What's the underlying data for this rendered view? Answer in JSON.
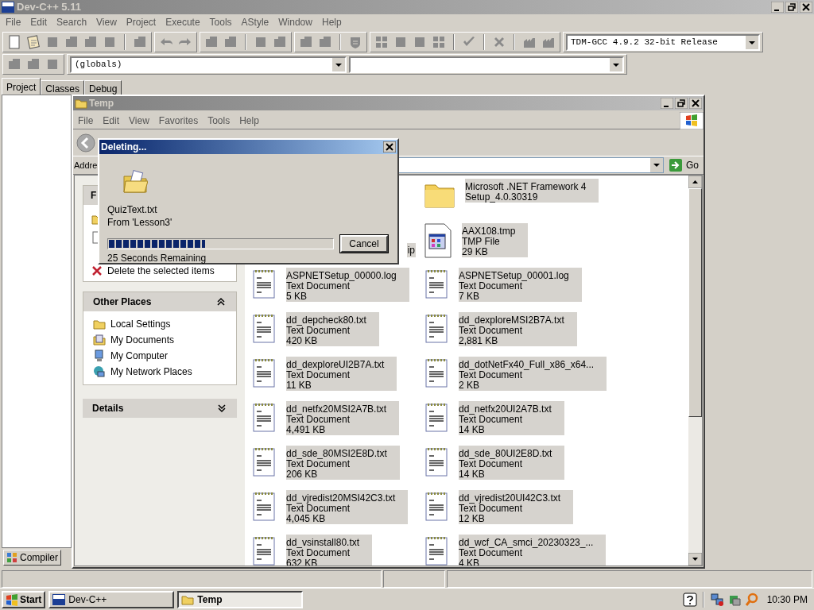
{
  "devcpp": {
    "title": "Dev-C++ 5.11",
    "menu": [
      "File",
      "Edit",
      "Search",
      "View",
      "Project",
      "Execute",
      "Tools",
      "AStyle",
      "Window",
      "Help"
    ],
    "compiler_select": "TDM-GCC 4.9.2 32-bit Release",
    "scope_select": "(globals)",
    "panel_tabs": [
      {
        "label": "Project",
        "selected": true
      },
      {
        "label": "Classes",
        "selected": false
      },
      {
        "label": "Debug",
        "selected": false
      }
    ],
    "bottom_tabs": [
      {
        "label": "Compiler",
        "selected": false
      }
    ]
  },
  "explorer": {
    "title": "Temp",
    "menu": [
      "File",
      "Edit",
      "View",
      "Favorites",
      "Tools",
      "Help"
    ],
    "address_label": "Addre",
    "go_button": "Go",
    "file_tasks": {
      "title": "F",
      "items": [
        "Delete the selected items"
      ]
    },
    "other_places": {
      "title": "Other Places",
      "expanded": true,
      "items": [
        {
          "label": "Local Settings",
          "kind": "folder"
        },
        {
          "label": "My Documents",
          "kind": "documents"
        },
        {
          "label": "My Computer",
          "kind": "computer"
        },
        {
          "label": "My Network Places",
          "kind": "network"
        }
      ]
    },
    "details": {
      "title": "Details",
      "expanded": false
    },
    "partial_file": "ip",
    "files": [
      {
        "kind": "folder",
        "name": "Microsoft .NET Framework 4",
        "type": "Setup_4.0.30319",
        "selected": true
      },
      {
        "kind": "tmp",
        "name": "AAX108.tmp",
        "type": "TMP File",
        "size": "29 KB",
        "selected": true
      },
      {
        "kind": "text",
        "name": "ASPNETSetup_00000.log",
        "type": "Text Document",
        "size": "5 KB",
        "selected": true
      },
      {
        "kind": "text",
        "name": "ASPNETSetup_00001.log",
        "type": "Text Document",
        "size": "7 KB",
        "selected": true
      },
      {
        "kind": "text",
        "name": "dd_depcheck80.txt",
        "type": "Text Document",
        "size": "420 KB",
        "selected": true
      },
      {
        "kind": "text",
        "name": "dd_dexploreMSI2B7A.txt",
        "type": "Text Document",
        "size": "2,881 KB",
        "selected": true
      },
      {
        "kind": "text",
        "name": "dd_dexploreUI2B7A.txt",
        "type": "Text Document",
        "size": "11 KB",
        "selected": true
      },
      {
        "kind": "text",
        "name": "dd_dotNetFx40_Full_x86_x64...",
        "type": "Text Document",
        "size": "2 KB",
        "selected": true
      },
      {
        "kind": "text",
        "name": "dd_netfx20MSI2A7B.txt",
        "type": "Text Document",
        "size": "4,491 KB",
        "selected": true
      },
      {
        "kind": "text",
        "name": "dd_netfx20UI2A7B.txt",
        "type": "Text Document",
        "size": "14 KB",
        "selected": true
      },
      {
        "kind": "text",
        "name": "dd_sde_80MSI2E8D.txt",
        "type": "Text Document",
        "size": "206 KB",
        "selected": true
      },
      {
        "kind": "text",
        "name": "dd_sde_80UI2E8D.txt",
        "type": "Text Document",
        "size": "14 KB",
        "selected": true
      },
      {
        "kind": "text",
        "name": "dd_vjredist20MSI42C3.txt",
        "type": "Text Document",
        "size": "4,045 KB",
        "selected": true
      },
      {
        "kind": "text",
        "name": "dd_vjredist20UI42C3.txt",
        "type": "Text Document",
        "size": "12 KB",
        "selected": true
      },
      {
        "kind": "text",
        "name": "dd_vsinstall80.txt",
        "type": "Text Document",
        "size": "632 KB",
        "selected": true
      },
      {
        "kind": "text",
        "name": "dd_wcf_CA_smci_20230323_...",
        "type": "Text Document",
        "size": "4 KB",
        "selected": true
      }
    ]
  },
  "dialog": {
    "title": "Deleting...",
    "file": "QuizText.txt",
    "from": "From 'Lesson3'",
    "level": 0.43,
    "remaining": "25 Seconds Remaining",
    "cancel": "Cancel"
  },
  "taskbar": {
    "start": "Start",
    "tasks": [
      {
        "label": "Dev-C++",
        "kind": "app",
        "selected": false
      },
      {
        "label": "Temp",
        "kind": "folder",
        "selected": true
      }
    ],
    "clock": "10:30 PM"
  }
}
